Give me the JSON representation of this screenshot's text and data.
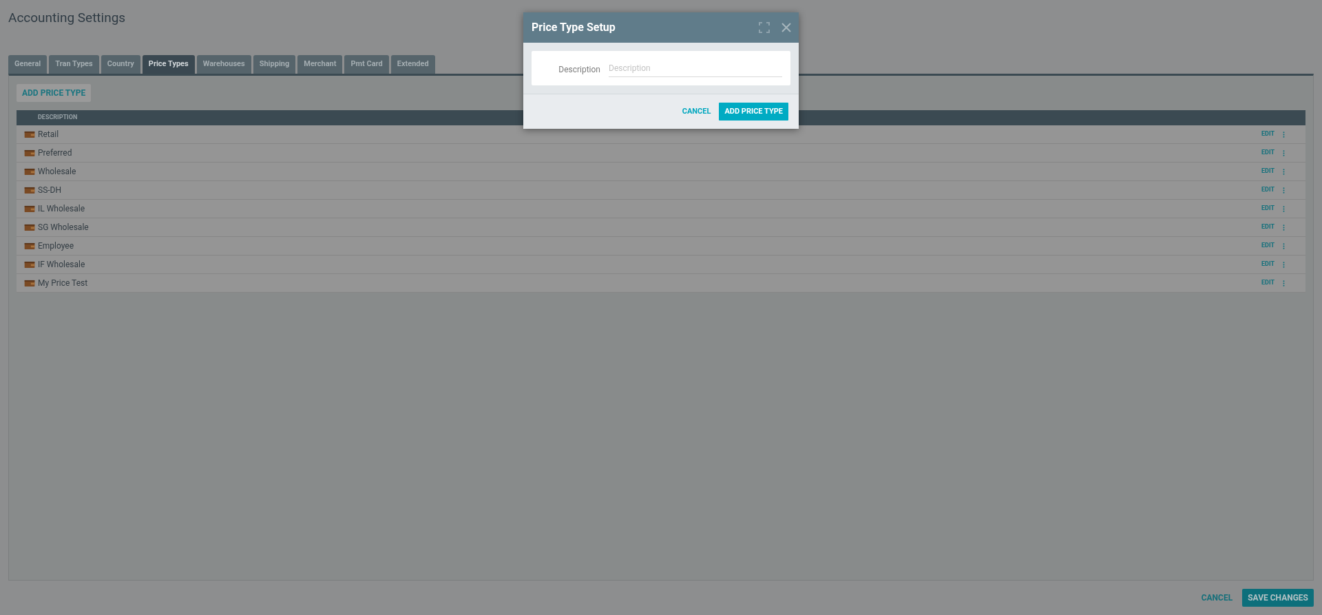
{
  "page": {
    "title": "Accounting Settings"
  },
  "tabs": [
    {
      "label": "General",
      "selected": false
    },
    {
      "label": "Tran Types",
      "selected": false
    },
    {
      "label": "Country",
      "selected": false
    },
    {
      "label": "Price Types",
      "selected": true
    },
    {
      "label": "Warehouses",
      "selected": false
    },
    {
      "label": "Shipping",
      "selected": false
    },
    {
      "label": "Merchant",
      "selected": false
    },
    {
      "label": "Pmt Card",
      "selected": false
    },
    {
      "label": "Extended",
      "selected": false
    }
  ],
  "add_button": "ADD PRICE TYPE",
  "table": {
    "columns": [
      "DESCRIPTION"
    ],
    "rows": [
      {
        "description": "Retail",
        "action": "EDIT"
      },
      {
        "description": "Preferred",
        "action": "EDIT"
      },
      {
        "description": "Wholesale",
        "action": "EDIT"
      },
      {
        "description": "SS-DH",
        "action": "EDIT"
      },
      {
        "description": "IL Wholesale",
        "action": "EDIT"
      },
      {
        "description": "SG Wholesale",
        "action": "EDIT"
      },
      {
        "description": "Employee",
        "action": "EDIT"
      },
      {
        "description": "IF Wholesale",
        "action": "EDIT"
      },
      {
        "description": "My Price Test",
        "action": "EDIT"
      }
    ]
  },
  "footer": {
    "cancel": "CANCEL",
    "save": "SAVE CHANGES"
  },
  "dialog": {
    "title": "Price Type Setup",
    "field_label": "Description",
    "placeholder": "Description",
    "cancel": "CANCEL",
    "submit": "ADD PRICE TYPE"
  }
}
